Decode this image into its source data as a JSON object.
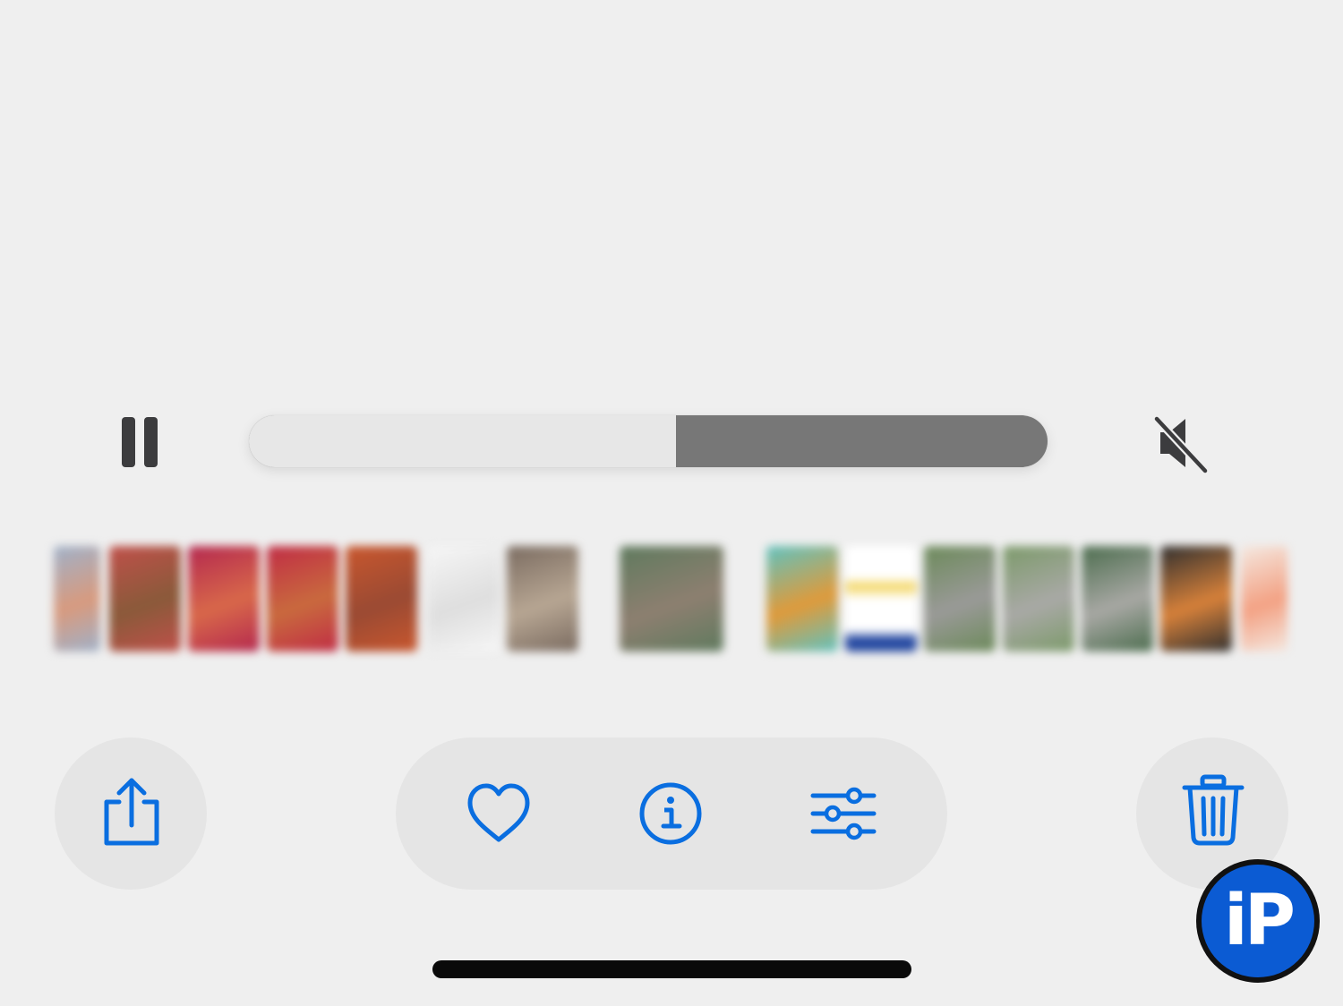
{
  "player": {
    "progress_fraction": 0.535,
    "muted": true,
    "state": "playing",
    "pause_icon": "pause-icon",
    "mute_icon": "speaker-slash-icon",
    "track_played_color": "#e7e7e7",
    "track_remaining_color": "#777777"
  },
  "thumbnails": [
    {
      "name": "thumb-1",
      "colors": [
        "#9fb1c9",
        "#d89a7e"
      ],
      "gap_before": false,
      "partial": true
    },
    {
      "name": "thumb-2",
      "colors": [
        "#c0504a",
        "#8a5a3a"
      ]
    },
    {
      "name": "thumb-3",
      "colors": [
        "#b4284f",
        "#d8684a"
      ]
    },
    {
      "name": "thumb-4",
      "colors": [
        "#c02c45",
        "#c96a3e"
      ]
    },
    {
      "name": "thumb-5",
      "colors": [
        "#c9572e",
        "#9a4a33"
      ]
    },
    {
      "name": "thumb-6",
      "colors": [
        "#f6f6f6",
        "#dedede"
      ]
    },
    {
      "name": "thumb-7",
      "colors": [
        "#7a6b60",
        "#b7a693"
      ]
    },
    {
      "name": "thumb-8",
      "colors": [
        "#5f7a5e",
        "#8d7f70"
      ],
      "wide": true
    },
    {
      "name": "thumb-9",
      "colors": [
        "#5fc2c0",
        "#e09a3a"
      ]
    },
    {
      "name": "thumb-10",
      "colors": [
        "#ffffff",
        "#f2d35a",
        "#2347a0"
      ]
    },
    {
      "name": "thumb-11",
      "colors": [
        "#6c8a5a",
        "#9a9a98"
      ]
    },
    {
      "name": "thumb-12",
      "colors": [
        "#7c9a6a",
        "#a9a9a6"
      ]
    },
    {
      "name": "thumb-13",
      "colors": [
        "#4c6d4e",
        "#a8a8a4"
      ]
    },
    {
      "name": "thumb-14",
      "colors": [
        "#2f2f2f",
        "#d7813a"
      ]
    },
    {
      "name": "thumb-15",
      "colors": [
        "#f4e8e0",
        "#f3a183"
      ],
      "partial": true
    }
  ],
  "toolbar": {
    "accent_color": "#0a6ee0",
    "share_icon": "share-icon",
    "favorite_icon": "heart-icon",
    "info_icon": "info-icon",
    "adjust_icon": "sliders-icon",
    "delete_icon": "trash-icon"
  },
  "watermark": {
    "text": "iP",
    "color": "#0b5bd3"
  }
}
